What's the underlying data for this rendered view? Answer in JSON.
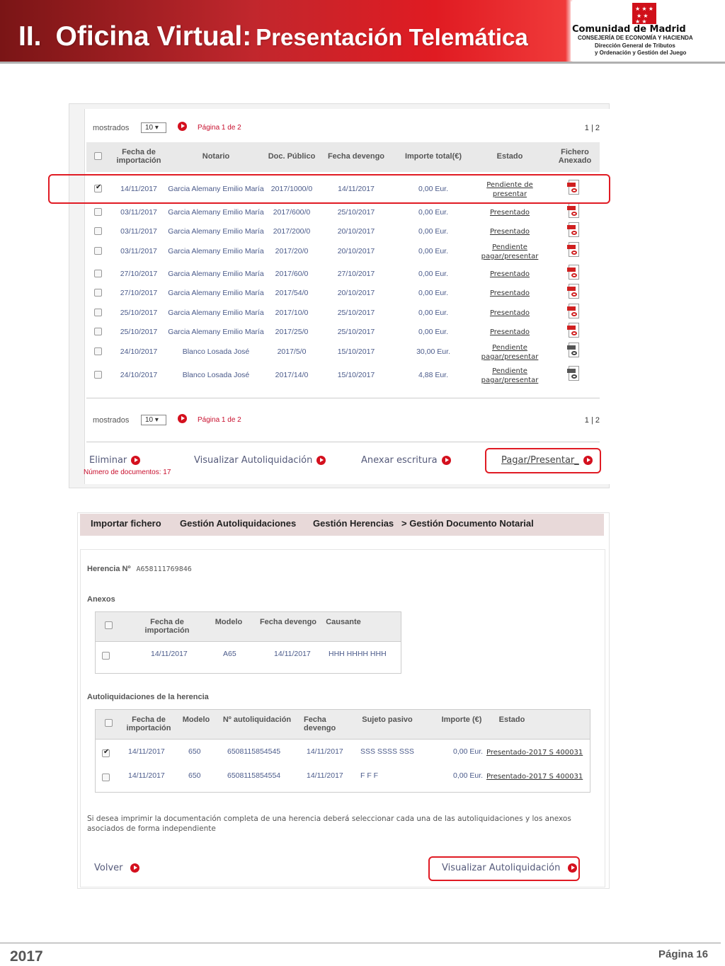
{
  "header": {
    "roman": "II.",
    "title_main": "Oficina Virtual:",
    "title_sub": "Presentación Telemática",
    "org_name": "Comunidad de Madrid",
    "org_line1": "CONSEJERÍA DE ECONOMÍA Y HACIENDA",
    "org_line2": "Dirección General de Tributos",
    "org_line3": "y Ordenación y Gestión del Juego",
    "brand_red": "#d0101a"
  },
  "list": {
    "pager_label": "mostrados",
    "pager_size": "10",
    "pager_text": "Página  1  de 2",
    "pager_nums": "1  |  2",
    "columns": [
      "Fecha de importación",
      "Notario",
      "Doc. Público",
      "Fecha devengo",
      "Importe total(€)",
      "Estado",
      "Fichero Anexado"
    ],
    "rows": [
      {
        "fecha": "14/11/2017",
        "notario": "Garcia Alemany Emilio María",
        "doc": "2017/1000/0",
        "devengo": "14/11/2017",
        "importe": "0,00 Eur.",
        "estado": "Pendiente de presentar",
        "checked": true,
        "icon": "pdf-red"
      },
      {
        "fecha": "03/11/2017",
        "notario": "Garcia Alemany Emilio María",
        "doc": "2017/600/0",
        "devengo": "25/10/2017",
        "importe": "0,00 Eur.",
        "estado": "Presentado",
        "checked": false,
        "icon": "pdf-red"
      },
      {
        "fecha": "03/11/2017",
        "notario": "Garcia Alemany Emilio María",
        "doc": "2017/200/0",
        "devengo": "20/10/2017",
        "importe": "0,00 Eur.",
        "estado": "Presentado",
        "checked": false,
        "icon": "pdf-red"
      },
      {
        "fecha": "03/11/2017",
        "notario": "Garcia Alemany Emilio María",
        "doc": "2017/20/0",
        "devengo": "20/10/2017",
        "importe": "0,00 Eur.",
        "estado": "Pendiente pagar/presentar",
        "checked": false,
        "icon": "pdf-red"
      },
      {
        "fecha": "27/10/2017",
        "notario": "Garcia Alemany Emilio María",
        "doc": "2017/60/0",
        "devengo": "27/10/2017",
        "importe": "0,00 Eur.",
        "estado": "Presentado",
        "checked": false,
        "icon": "pdf-red"
      },
      {
        "fecha": "27/10/2017",
        "notario": "Garcia Alemany Emilio María",
        "doc": "2017/54/0",
        "devengo": "20/10/2017",
        "importe": "0,00 Eur.",
        "estado": "Presentado",
        "checked": false,
        "icon": "pdf-red"
      },
      {
        "fecha": "25/10/2017",
        "notario": "Garcia Alemany Emilio María",
        "doc": "2017/10/0",
        "devengo": "25/10/2017",
        "importe": "0,00 Eur.",
        "estado": "Presentado",
        "checked": false,
        "icon": "pdf-red"
      },
      {
        "fecha": "25/10/2017",
        "notario": "Garcia Alemany Emilio María",
        "doc": "2017/25/0",
        "devengo": "25/10/2017",
        "importe": "0,00 Eur.",
        "estado": "Presentado",
        "checked": false,
        "icon": "pdf-red"
      },
      {
        "fecha": "24/10/2017",
        "notario": "Blanco Losada José",
        "doc": "2017/5/0",
        "devengo": "15/10/2017",
        "importe": "30,00 Eur.",
        "estado": "Pendiente pagar/presentar",
        "checked": false,
        "icon": "pdf-grey"
      },
      {
        "fecha": "24/10/2017",
        "notario": "Blanco Losada José",
        "doc": "2017/14/0",
        "devengo": "15/10/2017",
        "importe": "4,88 Eur.",
        "estado": "Pendiente pagar/presentar",
        "checked": false,
        "icon": "pdf-grey"
      }
    ],
    "actions": {
      "eliminar": "Eliminar",
      "visualizar": "Visualizar Autoliquidación",
      "anexar": "Anexar escritura",
      "pagar": "Pagar/Presentar_"
    },
    "ndocs": "Número de documentos: 17"
  },
  "detail": {
    "nav": {
      "importar": "Importar fichero",
      "gestion_auto": "Gestión Autoliquidaciones",
      "gestion_her": "Gestión Herencias",
      "current": "> Gestión Documento Notarial"
    },
    "herencia_label": "Herencia Nº",
    "herencia_value": "A658111769846",
    "anexos_title": "Anexos",
    "anexos_cols": [
      "Fecha de importación",
      "Modelo",
      "Fecha devengo",
      "Causante"
    ],
    "anexos_rows": [
      {
        "fecha": "14/11/2017",
        "modelo": "A65",
        "devengo": "14/11/2017",
        "causante": "HHH HHHH HHH"
      }
    ],
    "auto_title": "Autoliquidaciones de la herencia",
    "auto_cols": [
      "Fecha de importación",
      "Modelo",
      "Nº autoliquidación",
      "Fecha devengo",
      "Sujeto pasivo",
      "Importe (€)",
      "Estado"
    ],
    "auto_rows": [
      {
        "fecha": "14/11/2017",
        "modelo": "650",
        "num": "6508115854545",
        "devengo": "14/11/2017",
        "sujeto": "SSS SSSS SSS",
        "importe": "0,00 Eur.",
        "estado": "Presentado-2017 S 400031",
        "checked": true
      },
      {
        "fecha": "14/11/2017",
        "modelo": "650",
        "num": "6508115854554",
        "devengo": "14/11/2017",
        "sujeto": "F F F",
        "importe": "0,00 Eur.",
        "estado": "Presentado-2017 S 400031",
        "checked": false
      }
    ],
    "note": "Si desea imprimir la documentación completa de una herencia deberá seleccionar cada una de las autoliquidaciones y los anexos asociados de forma independiente",
    "volver": "Volver",
    "visualizar": "Visualizar Autoliquidación"
  },
  "footer": {
    "year": "2017",
    "page": "Página 16"
  }
}
